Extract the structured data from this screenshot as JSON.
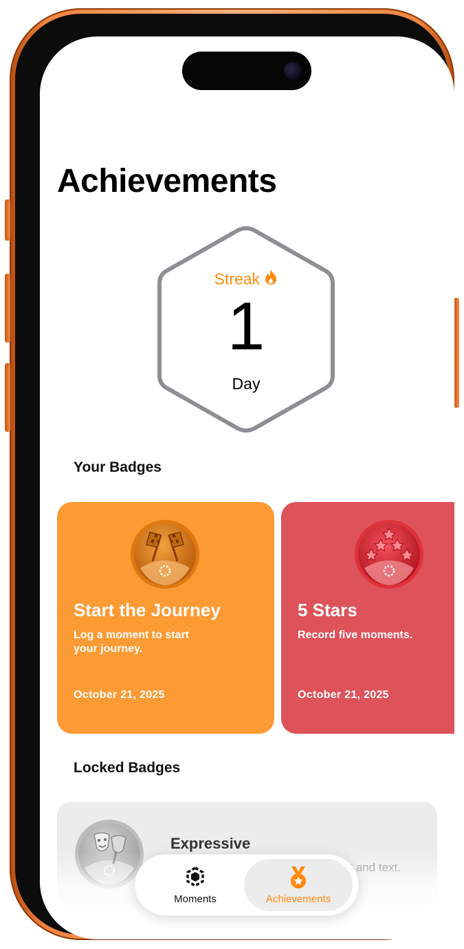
{
  "page": {
    "title": "Achievements"
  },
  "streak": {
    "label": "Streak",
    "value": "1",
    "unit": "Day",
    "icon": "flame-icon"
  },
  "your_badges": {
    "title": "Your Badges",
    "items": [
      {
        "title": "Start the Journey",
        "description": "Log a moment to start your journey.",
        "date": "October 21, 2025",
        "color": "#FC9A33",
        "icon": "checkered-flags-medal-icon"
      },
      {
        "title": "5 Stars",
        "description": "Record five moments.",
        "date": "October 21, 2025",
        "color": "#DE525A",
        "icon": "five-stars-medal-icon"
      }
    ]
  },
  "locked_badges": {
    "title": "Locked Badges",
    "items": [
      {
        "title": "Expressive",
        "description": "and text.",
        "icon": "theater-masks-medal-icon"
      }
    ]
  },
  "tabbar": {
    "tabs": [
      {
        "label": "Moments",
        "icon": "hexagon-dots-icon",
        "active": false
      },
      {
        "label": "Achievements",
        "icon": "medal-icon",
        "active": true
      }
    ],
    "active_color": "#FF8A10"
  }
}
